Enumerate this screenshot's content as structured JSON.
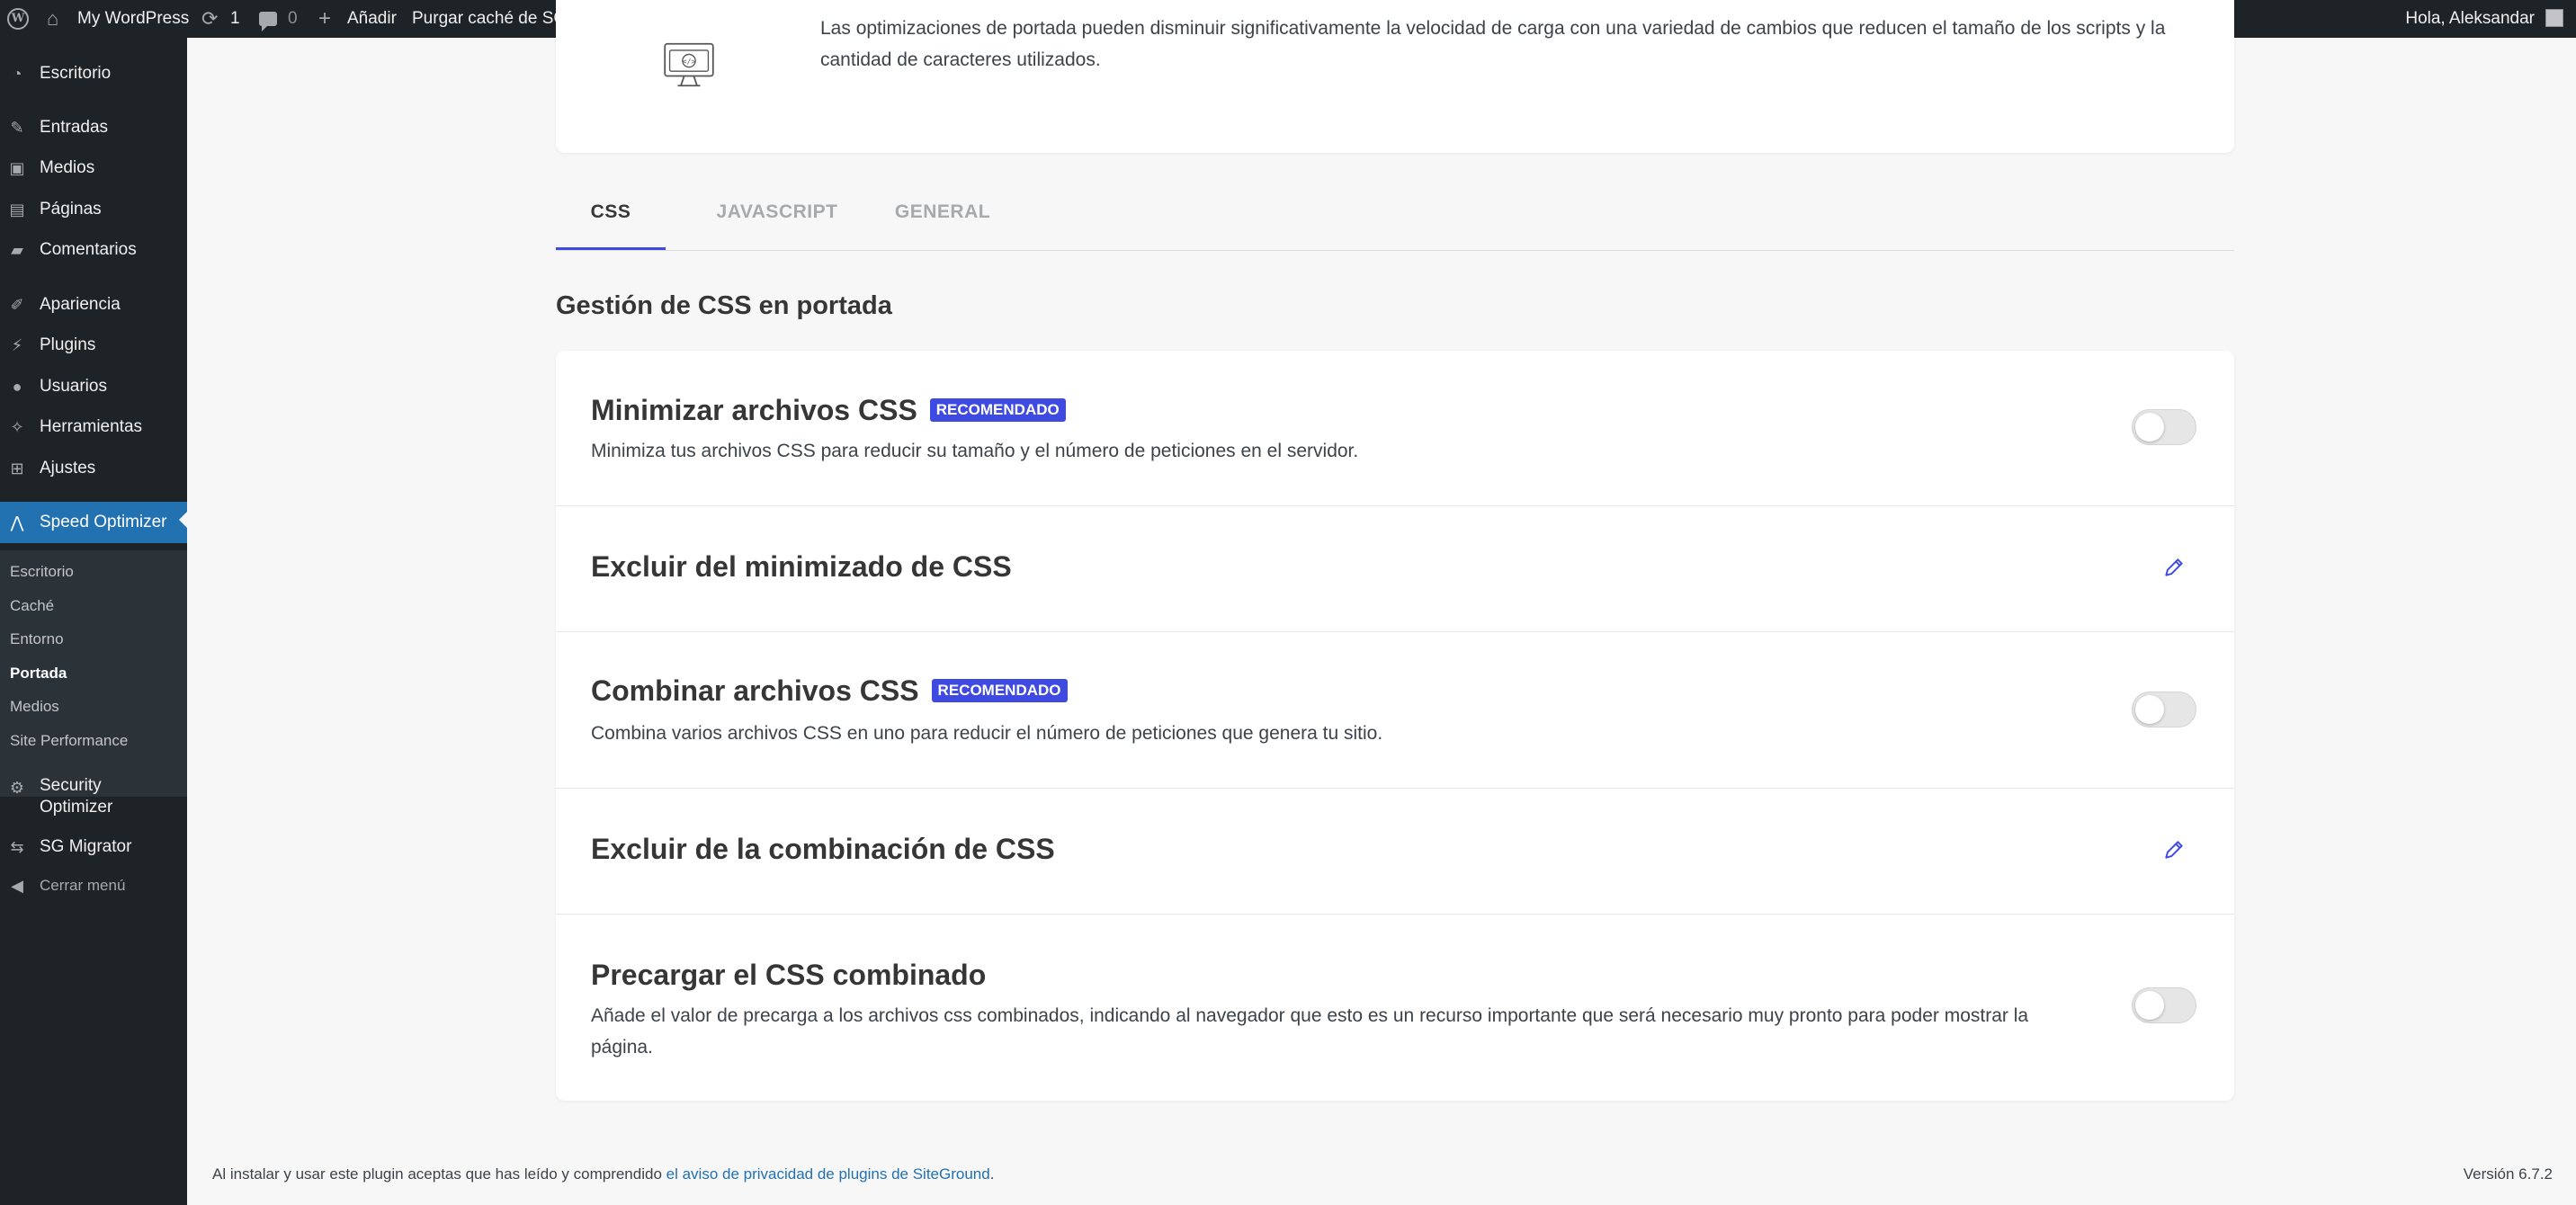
{
  "adminbar": {
    "site_name": "My WordPress",
    "updates_count": "1",
    "comments_count": "0",
    "new_label": "Añadir",
    "purge_label": "Purgar caché de SG",
    "howdy": "Hola, Aleksandar"
  },
  "sidebar": {
    "items": [
      {
        "label": "Escritorio",
        "icon": "dashboard-icon"
      },
      {
        "label": "Entradas",
        "icon": "pin-icon"
      },
      {
        "label": "Medios",
        "icon": "media-icon"
      },
      {
        "label": "Páginas",
        "icon": "page-icon"
      },
      {
        "label": "Comentarios",
        "icon": "comment-icon"
      },
      {
        "label": "Apariencia",
        "icon": "brush-icon"
      },
      {
        "label": "Plugins",
        "icon": "plugin-icon"
      },
      {
        "label": "Usuarios",
        "icon": "user-icon"
      },
      {
        "label": "Herramientas",
        "icon": "wrench-icon"
      },
      {
        "label": "Ajustes",
        "icon": "settings-icon"
      },
      {
        "label": "Speed Optimizer",
        "icon": "speed-optimizer-icon"
      },
      {
        "label": "Security Optimizer",
        "icon": "security-icon"
      },
      {
        "label": "SG Migrator",
        "icon": "migrator-icon"
      },
      {
        "label": "Cerrar menú",
        "icon": "collapse-icon"
      }
    ],
    "submenu": [
      "Escritorio",
      "Caché",
      "Entorno",
      "Portada",
      "Medios",
      "Site Performance"
    ]
  },
  "intro": {
    "description": "Las optimizaciones de portada pueden disminuir significativamente la velocidad de carga con una variedad de cambios que reducen el tamaño de los scripts y la cantidad de caracteres utilizados."
  },
  "tabs": [
    "CSS",
    "JAVASCRIPT",
    "GENERAL"
  ],
  "section_title": "Gestión de CSS en portada",
  "badge_label": "RECOMENDADO",
  "settings": [
    {
      "title": "Minimizar archivos CSS",
      "recommended": true,
      "description": "Minimiza tus archivos CSS para reducir su tamaño y el número de peticiones en el servidor.",
      "control": "toggle",
      "enabled": false
    },
    {
      "title": "Excluir del minimizado de CSS",
      "recommended": false,
      "description": "",
      "control": "edit"
    },
    {
      "title": "Combinar archivos CSS",
      "recommended": true,
      "description": "Combina varios archivos CSS en uno para reducir el número de peticiones que genera tu sitio.",
      "control": "toggle",
      "enabled": false
    },
    {
      "title": "Excluir de la combinación de CSS",
      "recommended": false,
      "description": "",
      "control": "edit"
    },
    {
      "title": "Precargar el CSS combinado",
      "recommended": false,
      "description": "Añade el valor de precarga a los archivos css combinados, indicando al navegador que esto es un recurso importante que será necesario muy pronto para poder mostrar la página.",
      "control": "toggle",
      "enabled": false
    }
  ],
  "footer": {
    "text": "Al instalar y usar este plugin aceptas que has leído y comprendido ",
    "link_text": "el aviso de privacidad de plugins de SiteGround",
    "after": ".",
    "version": "Versión 6.7.2"
  },
  "colors": {
    "accent": "#3e4ae1",
    "wp_dark": "#1d2327",
    "wp_blue": "#2271b1"
  }
}
